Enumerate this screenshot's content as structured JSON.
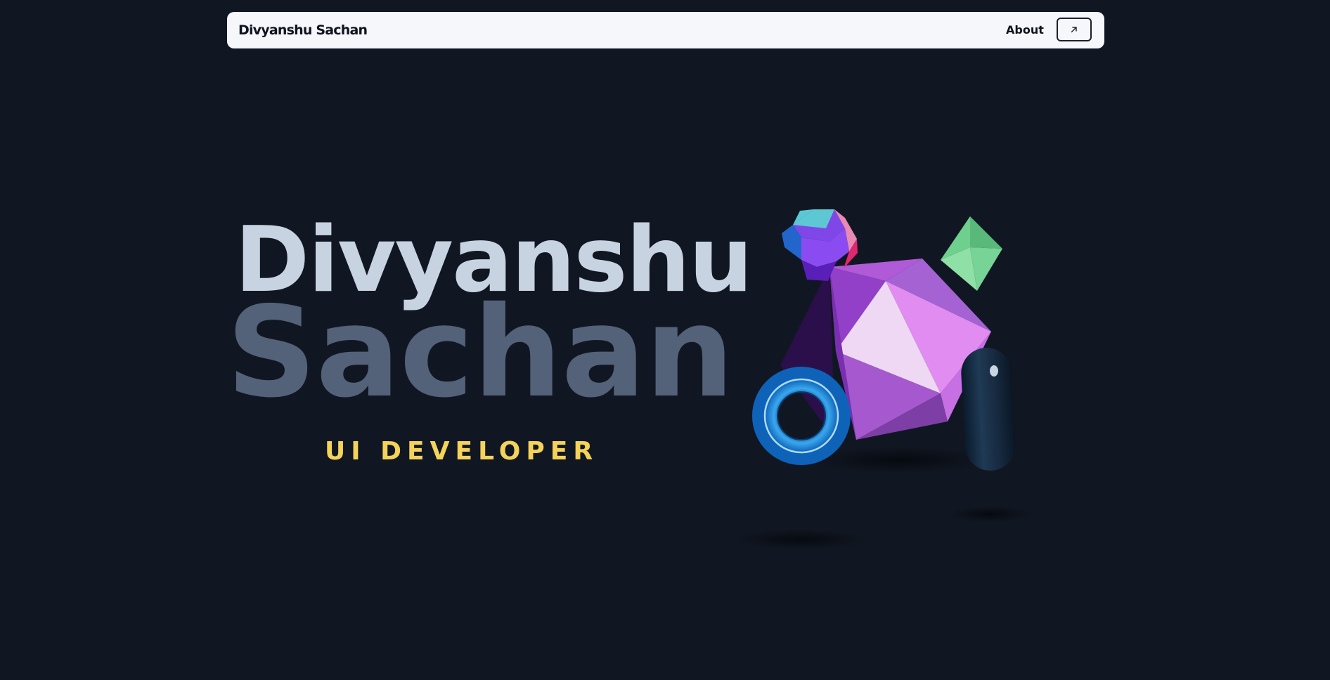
{
  "header": {
    "brand": "Divyanshu Sachan",
    "nav": {
      "about_label": "About"
    },
    "external_link_icon": "arrow-up-right-icon"
  },
  "hero": {
    "first_name": "Divyanshu",
    "last_name": "Sachan",
    "role": "UI DEVELOPER"
  },
  "colors": {
    "background": "#111722",
    "navbar_bg": "#f5f7fb",
    "first_name": "#c8d3e2",
    "last_name": "#536179",
    "role": "#f5d35a"
  },
  "illustration": {
    "shapes": [
      "dodecahedron",
      "icosahedron",
      "octahedron",
      "torus",
      "capsule"
    ]
  }
}
